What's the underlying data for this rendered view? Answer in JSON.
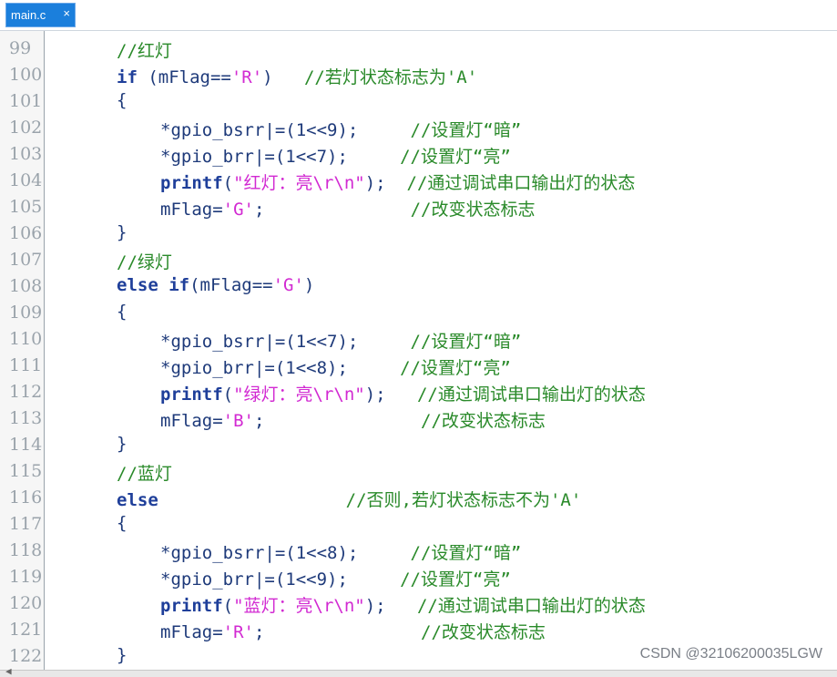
{
  "tab": {
    "label": "main.c",
    "close": "×"
  },
  "lines": [
    {
      "n": "99",
      "indent": 128,
      "parts": [
        {
          "t": "//红灯",
          "c": "cm"
        }
      ]
    },
    {
      "n": "100",
      "indent": 128,
      "parts": [
        {
          "t": "if",
          "c": "kw"
        },
        {
          "t": " (mFlag==",
          "c": "op"
        },
        {
          "t": "'R'",
          "c": "str"
        },
        {
          "t": ")   ",
          "c": "op"
        },
        {
          "t": "//若灯状态标志为'A'",
          "c": "cm"
        }
      ]
    },
    {
      "n": "101",
      "indent": 128,
      "parts": [
        {
          "t": "{",
          "c": "op"
        }
      ]
    },
    {
      "n": "102",
      "indent": 176,
      "parts": [
        {
          "t": "*gpio_bsrr|=(1<<9);     ",
          "c": "op"
        },
        {
          "t": "//设置灯“暗”",
          "c": "cm"
        }
      ]
    },
    {
      "n": "103",
      "indent": 176,
      "parts": [
        {
          "t": "*gpio_brr|=(1<<7);     ",
          "c": "op"
        },
        {
          "t": "//设置灯“亮”",
          "c": "cm"
        }
      ]
    },
    {
      "n": "104",
      "indent": 176,
      "parts": [
        {
          "t": "printf",
          "c": "fn"
        },
        {
          "t": "(",
          "c": "op"
        },
        {
          "t": "\"红灯：亮\\r\\n\"",
          "c": "str"
        },
        {
          "t": ");  ",
          "c": "op"
        },
        {
          "t": "//通过调试串口输出灯的状态",
          "c": "cm"
        }
      ]
    },
    {
      "n": "105",
      "indent": 176,
      "parts": [
        {
          "t": "mFlag=",
          "c": "op"
        },
        {
          "t": "'G'",
          "c": "str"
        },
        {
          "t": ";              ",
          "c": "op"
        },
        {
          "t": "//改变状态标志",
          "c": "cm"
        }
      ]
    },
    {
      "n": "106",
      "indent": 128,
      "parts": [
        {
          "t": "}",
          "c": "op"
        }
      ]
    },
    {
      "n": "107",
      "indent": 128,
      "parts": [
        {
          "t": "//绿灯",
          "c": "cm"
        }
      ]
    },
    {
      "n": "108",
      "indent": 128,
      "parts": [
        {
          "t": "else if",
          "c": "kw"
        },
        {
          "t": "(mFlag==",
          "c": "op"
        },
        {
          "t": "'G'",
          "c": "str"
        },
        {
          "t": ")",
          "c": "op"
        }
      ]
    },
    {
      "n": "109",
      "indent": 128,
      "parts": [
        {
          "t": "{",
          "c": "op"
        }
      ]
    },
    {
      "n": "110",
      "indent": 176,
      "parts": [
        {
          "t": "*gpio_bsrr|=(1<<7);     ",
          "c": "op"
        },
        {
          "t": "//设置灯“暗”",
          "c": "cm"
        }
      ]
    },
    {
      "n": "111",
      "indent": 176,
      "parts": [
        {
          "t": "*gpio_brr|=(1<<8);     ",
          "c": "op"
        },
        {
          "t": "//设置灯“亮”",
          "c": "cm"
        }
      ]
    },
    {
      "n": "112",
      "indent": 176,
      "parts": [
        {
          "t": "printf",
          "c": "fn"
        },
        {
          "t": "(",
          "c": "op"
        },
        {
          "t": "\"绿灯：亮\\r\\n\"",
          "c": "str"
        },
        {
          "t": ");   ",
          "c": "op"
        },
        {
          "t": "//通过调试串口输出灯的状态",
          "c": "cm"
        }
      ]
    },
    {
      "n": "113",
      "indent": 176,
      "parts": [
        {
          "t": "mFlag=",
          "c": "op"
        },
        {
          "t": "'B'",
          "c": "str"
        },
        {
          "t": ";               ",
          "c": "op"
        },
        {
          "t": "//改变状态标志",
          "c": "cm"
        }
      ]
    },
    {
      "n": "114",
      "indent": 128,
      "parts": [
        {
          "t": "}",
          "c": "op"
        }
      ]
    },
    {
      "n": "115",
      "indent": 128,
      "parts": [
        {
          "t": "//蓝灯",
          "c": "cm"
        }
      ]
    },
    {
      "n": "116",
      "indent": 128,
      "parts": [
        {
          "t": "else",
          "c": "kw"
        },
        {
          "t": "                  ",
          "c": "op"
        },
        {
          "t": "//否则,若灯状态标志不为'A'",
          "c": "cm"
        }
      ]
    },
    {
      "n": "117",
      "indent": 128,
      "parts": [
        {
          "t": "{",
          "c": "op"
        }
      ]
    },
    {
      "n": "118",
      "indent": 176,
      "parts": [
        {
          "t": "*gpio_bsrr|=(1<<8);     ",
          "c": "op"
        },
        {
          "t": "//设置灯“暗”",
          "c": "cm"
        }
      ]
    },
    {
      "n": "119",
      "indent": 176,
      "parts": [
        {
          "t": "*gpio_brr|=(1<<9);     ",
          "c": "op"
        },
        {
          "t": "//设置灯“亮”",
          "c": "cm"
        }
      ]
    },
    {
      "n": "120",
      "indent": 176,
      "parts": [
        {
          "t": "printf",
          "c": "fn"
        },
        {
          "t": "(",
          "c": "op"
        },
        {
          "t": "\"蓝灯：亮\\r\\n\"",
          "c": "str"
        },
        {
          "t": ");   ",
          "c": "op"
        },
        {
          "t": "//通过调试串口输出灯的状态",
          "c": "cm"
        }
      ]
    },
    {
      "n": "121",
      "indent": 176,
      "parts": [
        {
          "t": "mFlag=",
          "c": "op"
        },
        {
          "t": "'R'",
          "c": "str"
        },
        {
          "t": ";               ",
          "c": "op"
        },
        {
          "t": "//改变状态标志",
          "c": "cm"
        }
      ]
    },
    {
      "n": "122",
      "indent": 128,
      "parts": [
        {
          "t": "}",
          "c": "op"
        }
      ]
    }
  ],
  "watermark": "CSDN @32106200035LGW",
  "scroll_left_glyph": "◀"
}
